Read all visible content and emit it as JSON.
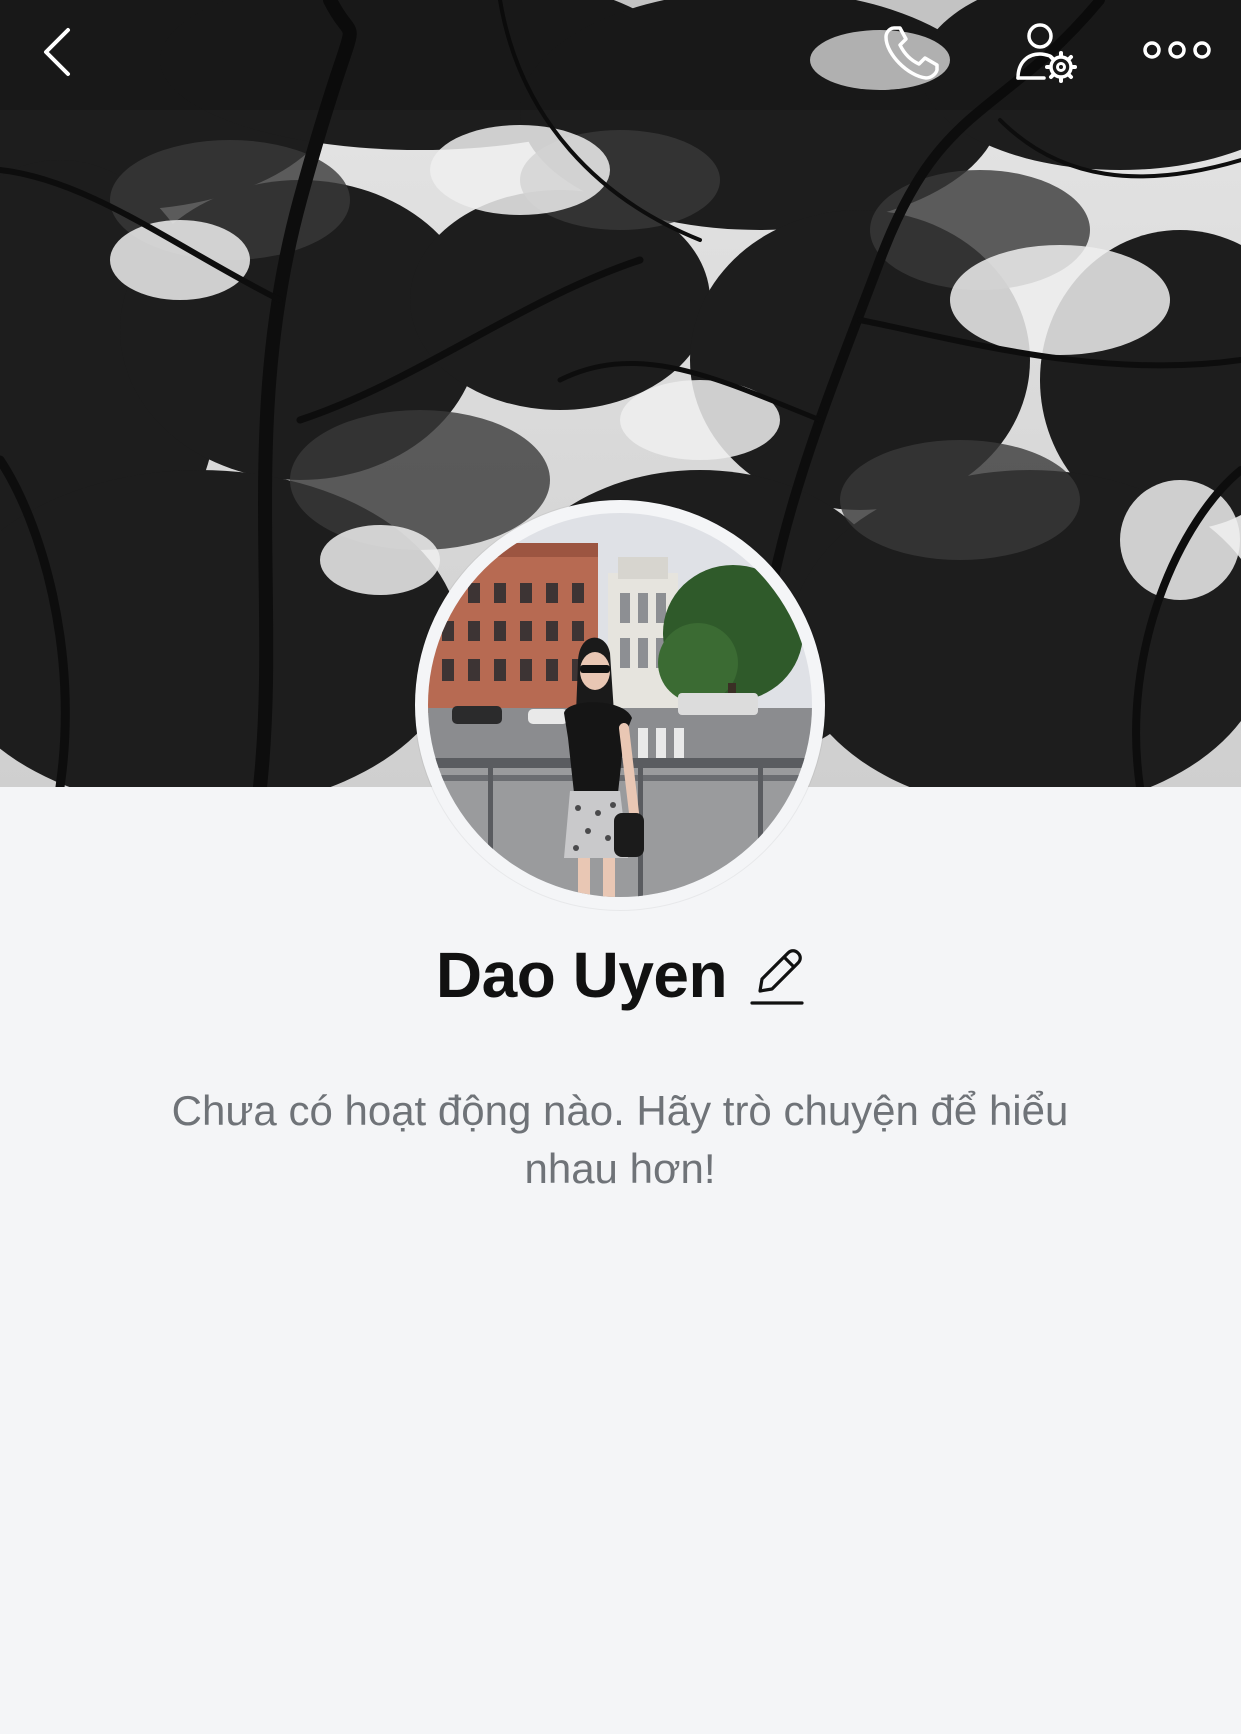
{
  "header": {
    "back_icon": "chevron-left-icon",
    "call_icon": "phone-icon",
    "settings_icon": "user-settings-icon",
    "more_icon": "more-dots-icon",
    "icon_color": "#ffffff"
  },
  "profile": {
    "name": "Dao Uyen",
    "edit_icon": "pencil-icon",
    "cover_theme": "monochrome tree silhouettes against sky",
    "avatar_theme": "woman standing on city street in front of brick building"
  },
  "activity": {
    "empty_message": "Chưa có hoạt động nào. Hãy trò chuyện để hiểu nhau hơn!"
  },
  "colors": {
    "background": "#f4f5f7",
    "name_text": "#111111",
    "message_text": "#6f7378"
  }
}
